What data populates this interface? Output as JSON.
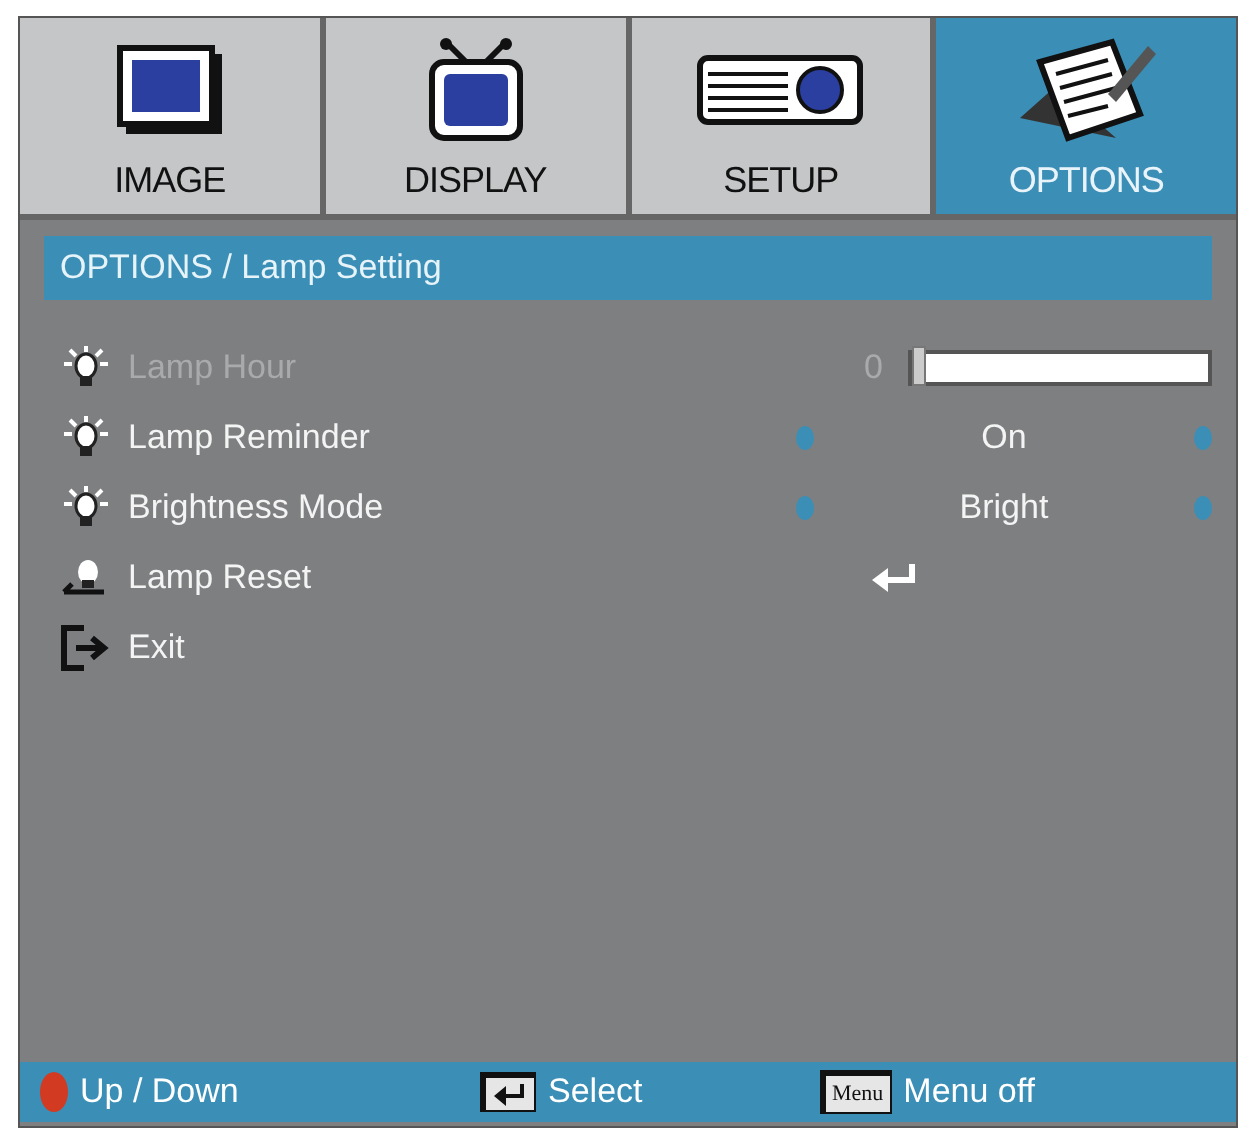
{
  "tabs": [
    {
      "label": "IMAGE",
      "selected": false
    },
    {
      "label": "DISPLAY",
      "selected": false
    },
    {
      "label": "SETUP",
      "selected": false
    },
    {
      "label": "OPTIONS",
      "selected": true
    }
  ],
  "heading": "OPTIONS / Lamp Setting",
  "items": [
    {
      "kind": "slider",
      "label": "Lamp Hour",
      "disabled": true,
      "reading": "0",
      "level": 0
    },
    {
      "kind": "option",
      "label": "Lamp Reminder",
      "disabled": false,
      "value": "On"
    },
    {
      "kind": "option",
      "label": "Brightness Mode",
      "disabled": false,
      "value": "Bright"
    },
    {
      "kind": "enter",
      "label": "Lamp Reset",
      "disabled": false
    },
    {
      "kind": "exit",
      "label": "Exit",
      "disabled": false
    }
  ],
  "footer": [
    {
      "kind": "updown",
      "label": "Up / Down"
    },
    {
      "kind": "enter",
      "label": "Select"
    },
    {
      "kind": "menu",
      "key": "Menu",
      "label": "Menu off"
    }
  ]
}
